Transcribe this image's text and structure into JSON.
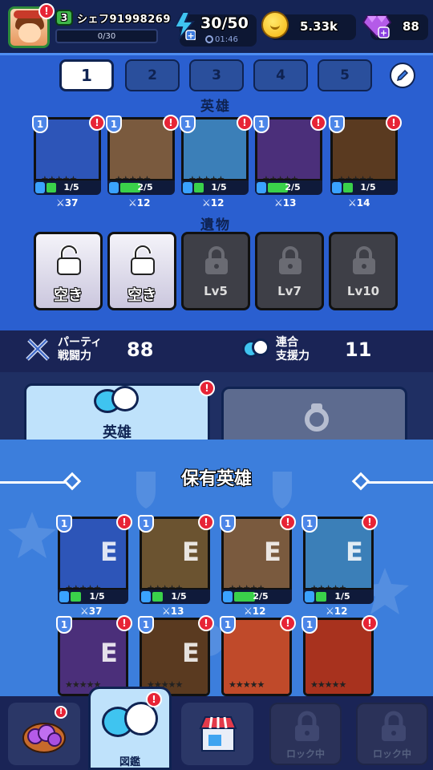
{
  "header": {
    "player_level": "3",
    "player_name": "シェフ91998269",
    "exp": "0/30",
    "stamina": "30/50",
    "stamina_timer": "01:46",
    "gold": "5.33k",
    "gems": "88"
  },
  "party": {
    "slots": [
      "1",
      "2",
      "3",
      "4",
      "5"
    ],
    "active_slot": "1",
    "heroes_label": "英雄",
    "relics_label": "遺物",
    "heroes": [
      {
        "level": "1",
        "progress": "1/5",
        "power": "37",
        "fill": 0.2,
        "color": "#2d55b8"
      },
      {
        "level": "1",
        "progress": "2/5",
        "power": "12",
        "fill": 0.4,
        "color": "#7a5a3e"
      },
      {
        "level": "1",
        "progress": "1/5",
        "power": "12",
        "fill": 0.2,
        "color": "#3b7fb8"
      },
      {
        "level": "1",
        "progress": "2/5",
        "power": "13",
        "fill": 0.4,
        "color": "#4b2f7a"
      },
      {
        "level": "1",
        "progress": "1/5",
        "power": "14",
        "fill": 0.2,
        "color": "#5a3a20"
      }
    ],
    "relics": [
      {
        "label": "空き",
        "locked": false
      },
      {
        "label": "空き",
        "locked": false
      },
      {
        "label": "Lv5",
        "locked": true
      },
      {
        "label": "Lv7",
        "locked": true
      },
      {
        "label": "Lv10",
        "locked": true
      }
    ]
  },
  "stats": {
    "party_power_label_1": "パーティ",
    "party_power_label_2": "戦闘力",
    "party_power": "88",
    "support_label_1": "連合",
    "support_label_2": "支援力",
    "support_power": "11"
  },
  "tabs": {
    "heroes": "英雄"
  },
  "collection": {
    "title": "保有英雄",
    "equip_mark": "E",
    "cards": [
      {
        "level": "1",
        "progress": "1/5",
        "power": "37",
        "equipped": true,
        "color": "#2d55b8"
      },
      {
        "level": "1",
        "progress": "1/5",
        "power": "13",
        "equipped": true,
        "color": "#6b5330"
      },
      {
        "level": "1",
        "progress": "2/5",
        "power": "12",
        "equipped": true,
        "color": "#7a5a3e"
      },
      {
        "level": "1",
        "progress": "1/5",
        "power": "12",
        "equipped": true,
        "color": "#3b7fb8"
      },
      {
        "level": "1",
        "progress": "",
        "power": "",
        "equipped": true,
        "color": "#4b2f7a"
      },
      {
        "level": "1",
        "progress": "",
        "power": "",
        "equipped": true,
        "color": "#5a3a20"
      },
      {
        "level": "1",
        "progress": "",
        "power": "",
        "equipped": false,
        "color": "#c04a2a"
      },
      {
        "level": "1",
        "progress": "",
        "power": "",
        "equipped": false,
        "color": "#a8321e"
      }
    ]
  },
  "nav": {
    "dex_label": "図鑑",
    "locked_label_1": "ロック中",
    "locked_label_2": "ロック中"
  }
}
